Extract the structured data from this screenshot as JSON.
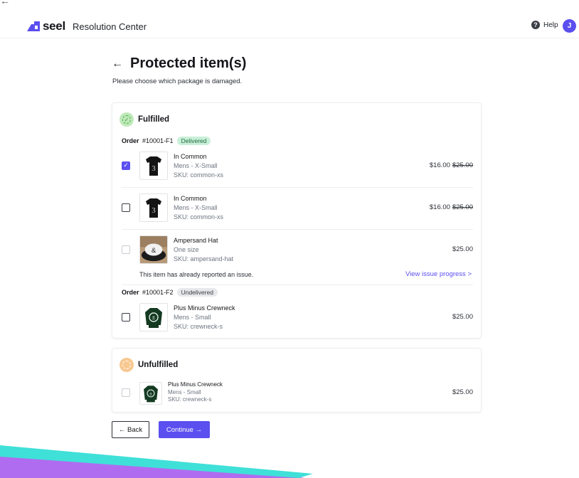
{
  "header": {
    "back_arrow": "←",
    "logo_text": "seel",
    "app_title": "Resolution Center",
    "help_label": "Help",
    "help_icon_glyph": "?",
    "avatar_initial": "J"
  },
  "page": {
    "back_arrow": "←",
    "title": "Protected item(s)",
    "subtitle": "Please choose which package is damaged."
  },
  "fulfilled": {
    "title": "Fulfilled",
    "orders": [
      {
        "label": "Order",
        "number": "#10001-F1",
        "status": "Delivered",
        "items": [
          {
            "name": "In Common",
            "variant": "Mens - X-Small",
            "sku": "SKU: common-xs",
            "price": "$16.00",
            "original_price": "$25.00",
            "checked": true
          },
          {
            "name": "In Common",
            "variant": "Mens - X-Small",
            "sku": "SKU: common-xs",
            "price": "$16.00",
            "original_price": "$25.00",
            "checked": false
          },
          {
            "name": "Ampersand Hat",
            "variant": "One size",
            "sku": "SKU: ampersand-hat",
            "price": "$25.00",
            "disabled": true,
            "notice": "This item has already reported an issue.",
            "link": "View issue progress >"
          }
        ]
      },
      {
        "label": "Order",
        "number": "#10001-F2",
        "status": "Undelivered",
        "items": [
          {
            "name": "Plus Minus Crewneck",
            "variant": "Mens - Small",
            "sku": "SKU: crewneck-s",
            "price": "$25.00",
            "checked": false
          }
        ]
      }
    ]
  },
  "unfulfilled": {
    "title": "Unfulfilled",
    "items": [
      {
        "name": "Plus Minus Crewneck",
        "variant": "Mens - Small",
        "sku": "SKU: crewneck-s",
        "price": "$25.00",
        "disabled": true
      }
    ]
  },
  "actions": {
    "back_label": "← Back",
    "continue_label": "Continue →"
  },
  "colors": {
    "accent": "#5b4ff0",
    "delivered_badge": "#c9efd8",
    "undelivered_badge": "#e7e8eb",
    "decor_purple": "#b06cf0",
    "decor_teal": "#3fe0d8"
  },
  "icons": [
    "back-arrow-icon",
    "seel-logo-icon",
    "help-icon",
    "fulfilled-status-icon",
    "unfulfilled-status-icon",
    "checkmark-icon"
  ]
}
